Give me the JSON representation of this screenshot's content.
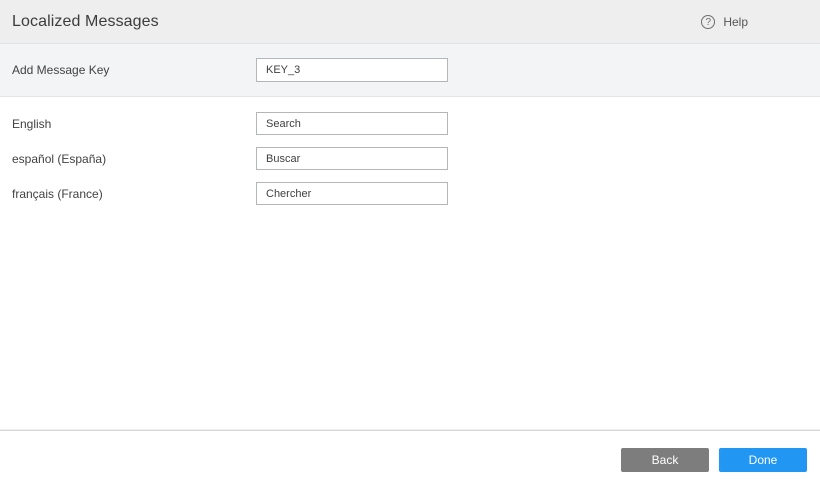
{
  "header": {
    "title": "Localized Messages",
    "help": {
      "label": "Help",
      "icon": "question-mark-circle",
      "icon_glyph": "?"
    }
  },
  "message_key": {
    "label": "Add Message Key",
    "value": "KEY_3"
  },
  "translations": [
    {
      "label": "English",
      "value": "Search"
    },
    {
      "label": "español (España)",
      "value": "Buscar"
    },
    {
      "label": "français (France)",
      "value": "Chercher"
    }
  ],
  "footer": {
    "back_label": "Back",
    "done_label": "Done"
  },
  "colors": {
    "header_bg": "#eeeeee",
    "key_section_bg": "#f3f4f6",
    "back_button_bg": "#7d7d7d",
    "done_button_bg": "#2196f3"
  }
}
